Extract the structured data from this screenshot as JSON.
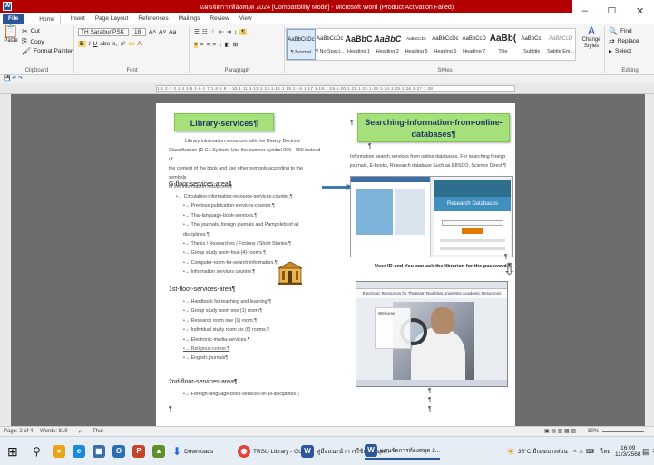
{
  "title": "แผนจัดการห้องสมุด 2024 [Compatibility Mode] - Microsoft Word (Product Activation Failed)",
  "ribbon_tabs": [
    "File",
    "Home",
    "Insert",
    "Page Layout",
    "References",
    "Mailings",
    "Review",
    "View"
  ],
  "clipboard": {
    "cut": "Cut",
    "copy": "Copy",
    "paste": "Paste",
    "format_painter": "Format Painter",
    "label": "Clipboard"
  },
  "font": {
    "name": "TH SarabunPSK",
    "size": "18",
    "label": "Font"
  },
  "paragraph": {
    "label": "Paragraph"
  },
  "styles": {
    "label": "Styles",
    "items": [
      {
        "preview": "AaBbCcDc",
        "name": "¶ Normal"
      },
      {
        "preview": "AaBbCcDc",
        "name": "¶ No Spaci..."
      },
      {
        "preview": "AaBbC",
        "name": "Heading 1"
      },
      {
        "preview": "AaBbC",
        "name": "Heading 2"
      },
      {
        "preview": "AaBbCcDc",
        "name": "Heading 5"
      },
      {
        "preview": "AaBbCcDc",
        "name": "Heading 6"
      },
      {
        "preview": "AaBbCcD",
        "name": "Heading 7"
      },
      {
        "preview": "AaBb(",
        "name": "Title"
      },
      {
        "preview": "AaBbCcI",
        "name": "Subtitle"
      },
      {
        "preview": "AaBbCcD",
        "name": "Subtle Em..."
      }
    ],
    "change": "Change Styles"
  },
  "editing": {
    "find": "Find",
    "replace": "Replace",
    "select": "Select",
    "label": "Editing"
  },
  "ruler_text": "1·1·2·1·3·1·4·1·5·1·6·1·7·1·8·1·9·1·10·1·11·1·12·1·13·1·14·1·15·1·16·1·17·1·18·1·19·1·20·1·21·1·22·1·23·1·24·1·25·1·26·1·27·1·28",
  "doc": {
    "left_heading": "Library-services¶",
    "intro": [
      "Library information resources with the Dewey Decimal",
      "Classification (D.C.) System. Use the number symbol 000 - 900 instead of",
      "the content of the book and use other symbols according to the symbols",
      "of the information resources.¶"
    ],
    "g_floor": "G-floor-services-area¶",
    "g_items": [
      "Circulation-information-resource-services-counter.¶",
      "Previous publication-services-counter.¶",
      "Thai-language-book-services.¶",
      "Thai journals, foreign journals and Pamphlets of all disciplines.¶",
      "Thesis / Researches / Fictions / Short Stories.¶",
      "Group study room-four-(4)-rooms.¶",
      "Computer-room-for-search-information.¶",
      "Information services counter.¶"
    ],
    "first_floor": "1st-floor-services-area¶",
    "first_items": [
      "Handbook for teaching and learning.¶",
      "Group study room one (1) room.¶",
      "Research room one (1) room.¶",
      "Individual study room six (6) rooms.¶",
      "Electronic-media-services.¶",
      "Religious-corner.¶",
      "English-journals¶"
    ],
    "second_floor": "2nd-floor-services-area¶",
    "second_items": [
      "Foreign-language-book-services-of-all-disciplines.¶"
    ],
    "right_heading": "Searching-information-from-online-databases¶",
    "right_para": [
      "Information search services from online databases, For searching foreign",
      "journals, E-books, Research database Such as EBSCO, Science Direct.¶"
    ],
    "password_note": "User-ID-and-You-can-ask-the-librarian-for-the-password.¶",
    "shot1_band": "Research Databases",
    "shot2_title": "Electronic Resources for Thepsatri Rajabhat University Academic Resources",
    "shot2_card": "Welcome"
  },
  "status": {
    "page": "Page: 2 of 4",
    "words": "Words: 819",
    "lang": "Thai",
    "zoom": "80%"
  },
  "taskbar": {
    "downloads": "Downloads",
    "chrome": "TRSU Library - Goo...",
    "word1": "คู่มือแนะนำการใช้ห้องสมุด...",
    "word2": "แผนจัดการห้องสมุด 2...",
    "weather": "35°C มีเมฆบางส่วน",
    "lang": "ไทย",
    "time": "16:09",
    "date": "11/3/2568",
    "notif": "3"
  }
}
